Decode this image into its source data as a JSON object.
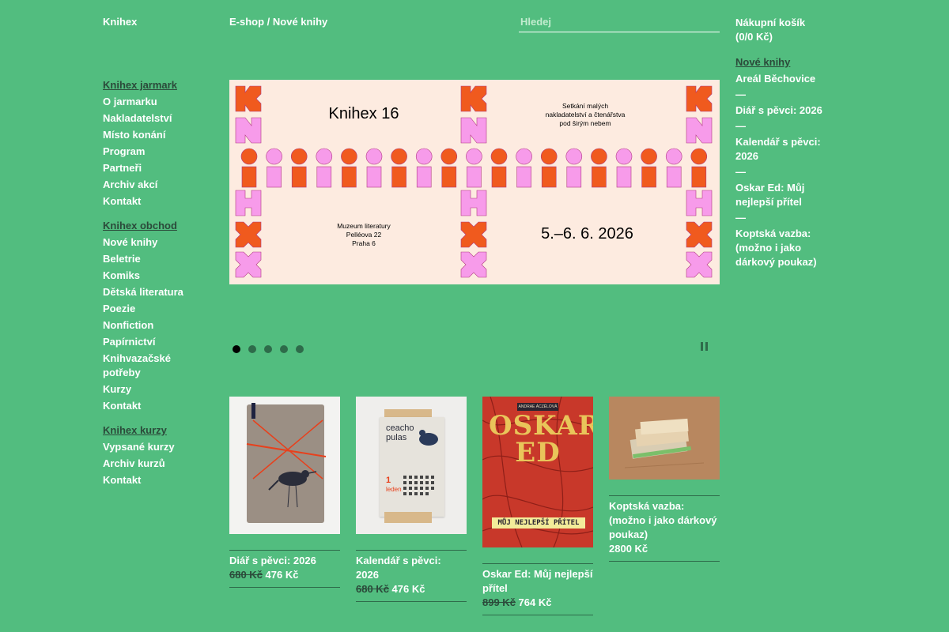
{
  "header": {
    "brand": "Knihex",
    "breadcrumb": "E-shop / Nové knihy",
    "search_placeholder": "Hledej",
    "cart_label": "Nákupní košík",
    "cart_value": "(0/0 Kč)"
  },
  "leftnav": {
    "groups": [
      {
        "head": "Knihex jarmark",
        "items": [
          "O jarmarku",
          "Nakladatelství",
          "Místo konání",
          "Program",
          "Partneři",
          "Archiv akcí",
          "Kontakt"
        ]
      },
      {
        "head": "Knihex obchod",
        "items": [
          "Nové knihy",
          "Beletrie",
          "Komiks",
          "Dětská literatura",
          "Poezie",
          "Nonfiction",
          "Papírnictví",
          "Knihvazačské potřeby",
          "Kurzy",
          "Kontakt"
        ]
      },
      {
        "head": "Knihex kurzy",
        "items": [
          "Vypsané kurzy",
          "Archiv kurzů",
          "Kontakt"
        ]
      }
    ]
  },
  "banner": {
    "title": "Knihex 16",
    "tagline": "Setkání malých\nnakladatelství a čtenářstva\npod širým nebem",
    "venue": "Muzeum literatury\nPelléova 22\nPraha 6",
    "dates": "5.–6. 6. 2026",
    "dots": 5,
    "active_dot": 0,
    "colors": {
      "orange": "#f05a1e",
      "pink": "#f79bea",
      "bg": "#fdebe0"
    }
  },
  "products": [
    {
      "title": "Diář s pěvci: 2026",
      "old_price": "680 Kč",
      "price": "476 Kč"
    },
    {
      "title": "Kalendář s pěvci: 2026",
      "old_price": "680 Kč",
      "price": "476 Kč"
    },
    {
      "title": "Oskar Ed: Můj nejlepší přítel",
      "old_price": "899 Kč",
      "price": "764 Kč",
      "cover_title": "OSKAR ED",
      "cover_subtitle": "MŮJ NEJLEPŠÍ PŘÍTEL",
      "cover_author": "ANDRAE ÁCZÉLOVÁ"
    },
    {
      "title": "Koptská vazba: (možno i jako dárkový poukaz)",
      "old_price": "",
      "price": "2800 Kč"
    }
  ],
  "sidelist": {
    "head": "Nové knihy",
    "items": [
      "Areál Běchovice",
      "Diář s pěvci: 2026",
      "Kalendář s pěvci: 2026",
      "Oskar Ed: Můj nejlepší přítel",
      "Koptská vazba: (možno i jako dárkový poukaz)"
    ],
    "separator": "—"
  },
  "calendar": {
    "word": "ceachopulas",
    "month_number": "1",
    "month_name": "leden"
  }
}
